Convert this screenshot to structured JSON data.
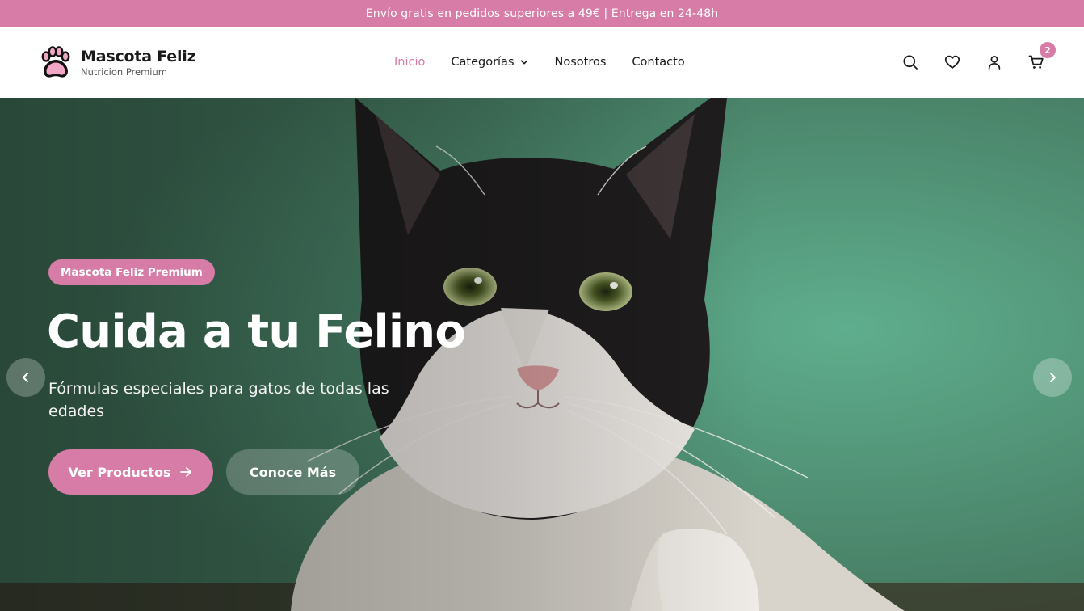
{
  "announcement": "Envío gratis en pedidos superiores a 49€ | Entrega en 24-48h",
  "brand": {
    "name": "Mascota Feliz",
    "tagline": "Nutricion Premium",
    "logo_icon": "paw-icon"
  },
  "nav": {
    "items": [
      {
        "label": "Inicio",
        "active": true
      },
      {
        "label": "Categorías",
        "dropdown": true
      },
      {
        "label": "Nosotros"
      },
      {
        "label": "Contacto"
      }
    ]
  },
  "actions": {
    "icons": [
      "search-icon",
      "heart-icon",
      "user-icon",
      "cart-icon"
    ],
    "cart_count": "2"
  },
  "hero": {
    "badge": "Mascota Feliz Premium",
    "title": "Cuida a tu Felino",
    "subtitle": "Fórmulas especiales para gatos de todas las edades",
    "primary_cta": "Ver Productos",
    "secondary_cta": "Conoce Más"
  },
  "colors": {
    "accent": "#d67ca6",
    "hero_bg": "#4f8f72",
    "text": "#1a1a1a"
  }
}
